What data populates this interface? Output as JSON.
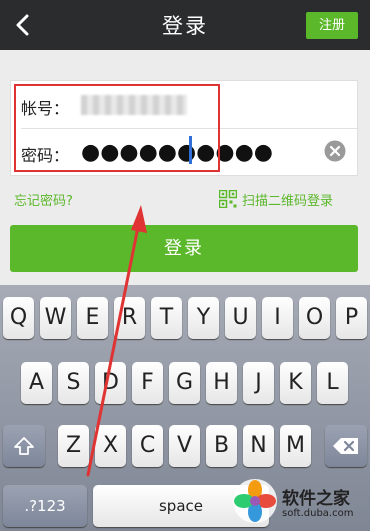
{
  "navbar": {
    "title": "登录",
    "register_label": "注册"
  },
  "form": {
    "account_label": "帐号：",
    "account_value": "",
    "password_label": "密码：",
    "password_masked": "●●●●●●●●●●"
  },
  "links": {
    "forgot": "忘记密码?",
    "qr_login": "扫描二维码登录"
  },
  "login_button": "登录",
  "keyboard": {
    "row1": [
      "Q",
      "W",
      "E",
      "R",
      "T",
      "Y",
      "U",
      "I",
      "O",
      "P"
    ],
    "row2": [
      "A",
      "S",
      "D",
      "F",
      "G",
      "H",
      "J",
      "K",
      "L"
    ],
    "row3": [
      "Z",
      "X",
      "C",
      "V",
      "B",
      "N",
      "M"
    ],
    "numbers_key": ".?123",
    "space_key": "space"
  },
  "watermark": {
    "name": "软件之家",
    "url": "soft.duba.com"
  },
  "colors": {
    "accent": "#5cb82b",
    "navbar": "#2b2c2e",
    "highlight": "#e03333"
  },
  "icons": [
    "back-icon",
    "clear-icon",
    "qr-code-icon",
    "shift-icon",
    "delete-icon"
  ]
}
